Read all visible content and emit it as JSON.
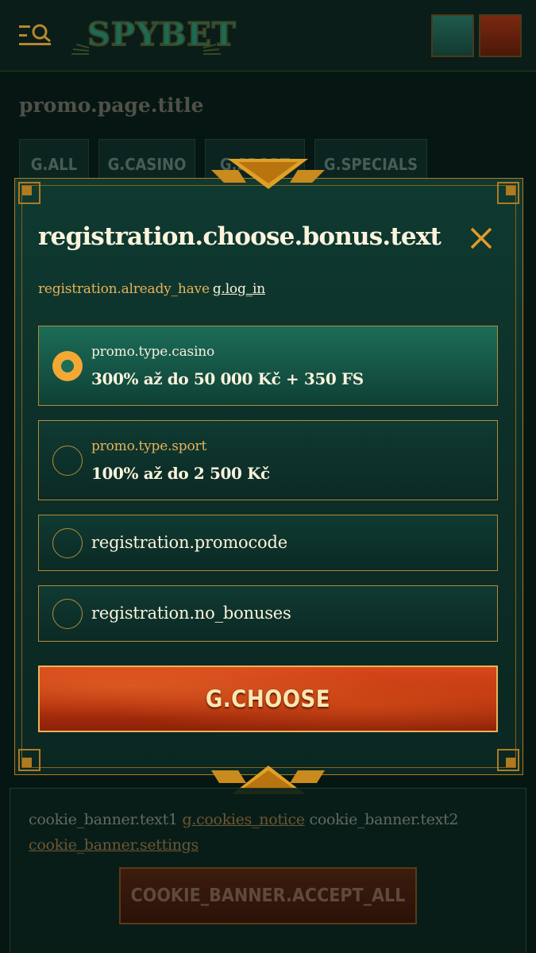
{
  "header": {
    "logo_text": "SPYBET",
    "colors": {
      "teal_button": "#1f5a4c",
      "red_button": "#7a2810"
    }
  },
  "page": {
    "title": "promo.page.title",
    "filter_tabs": [
      "G.ALL",
      "G.CASINO",
      "G.SPORT",
      "G.SPECIALS"
    ]
  },
  "modal": {
    "title": "registration.choose.bonus.text",
    "already_have": "registration.already_have",
    "login_link": "g.log_in",
    "options": [
      {
        "type": "promo.type.casino",
        "amount": "300% až do 50 000 Kč + 350 FS",
        "selected": true
      },
      {
        "type": "promo.type.sport",
        "amount": "100% až do 2 500 Kč",
        "selected": false
      },
      {
        "label": "registration.promocode",
        "selected": false
      },
      {
        "label": "registration.no_bonuses",
        "selected": false
      }
    ],
    "choose_button": "G.CHOOSE",
    "colors": {
      "accent": "#f3a834",
      "border_gold": "#b48a38",
      "button_orange": "#d8481a"
    }
  },
  "cookie_banner": {
    "text1": "cookie_banner.text1",
    "notice_link": "g.cookies_notice",
    "text2": "cookie_banner.text2",
    "settings_link": "cookie_banner.settings",
    "accept_button": "COOKIE_BANNER.ACCEPT_ALL"
  }
}
